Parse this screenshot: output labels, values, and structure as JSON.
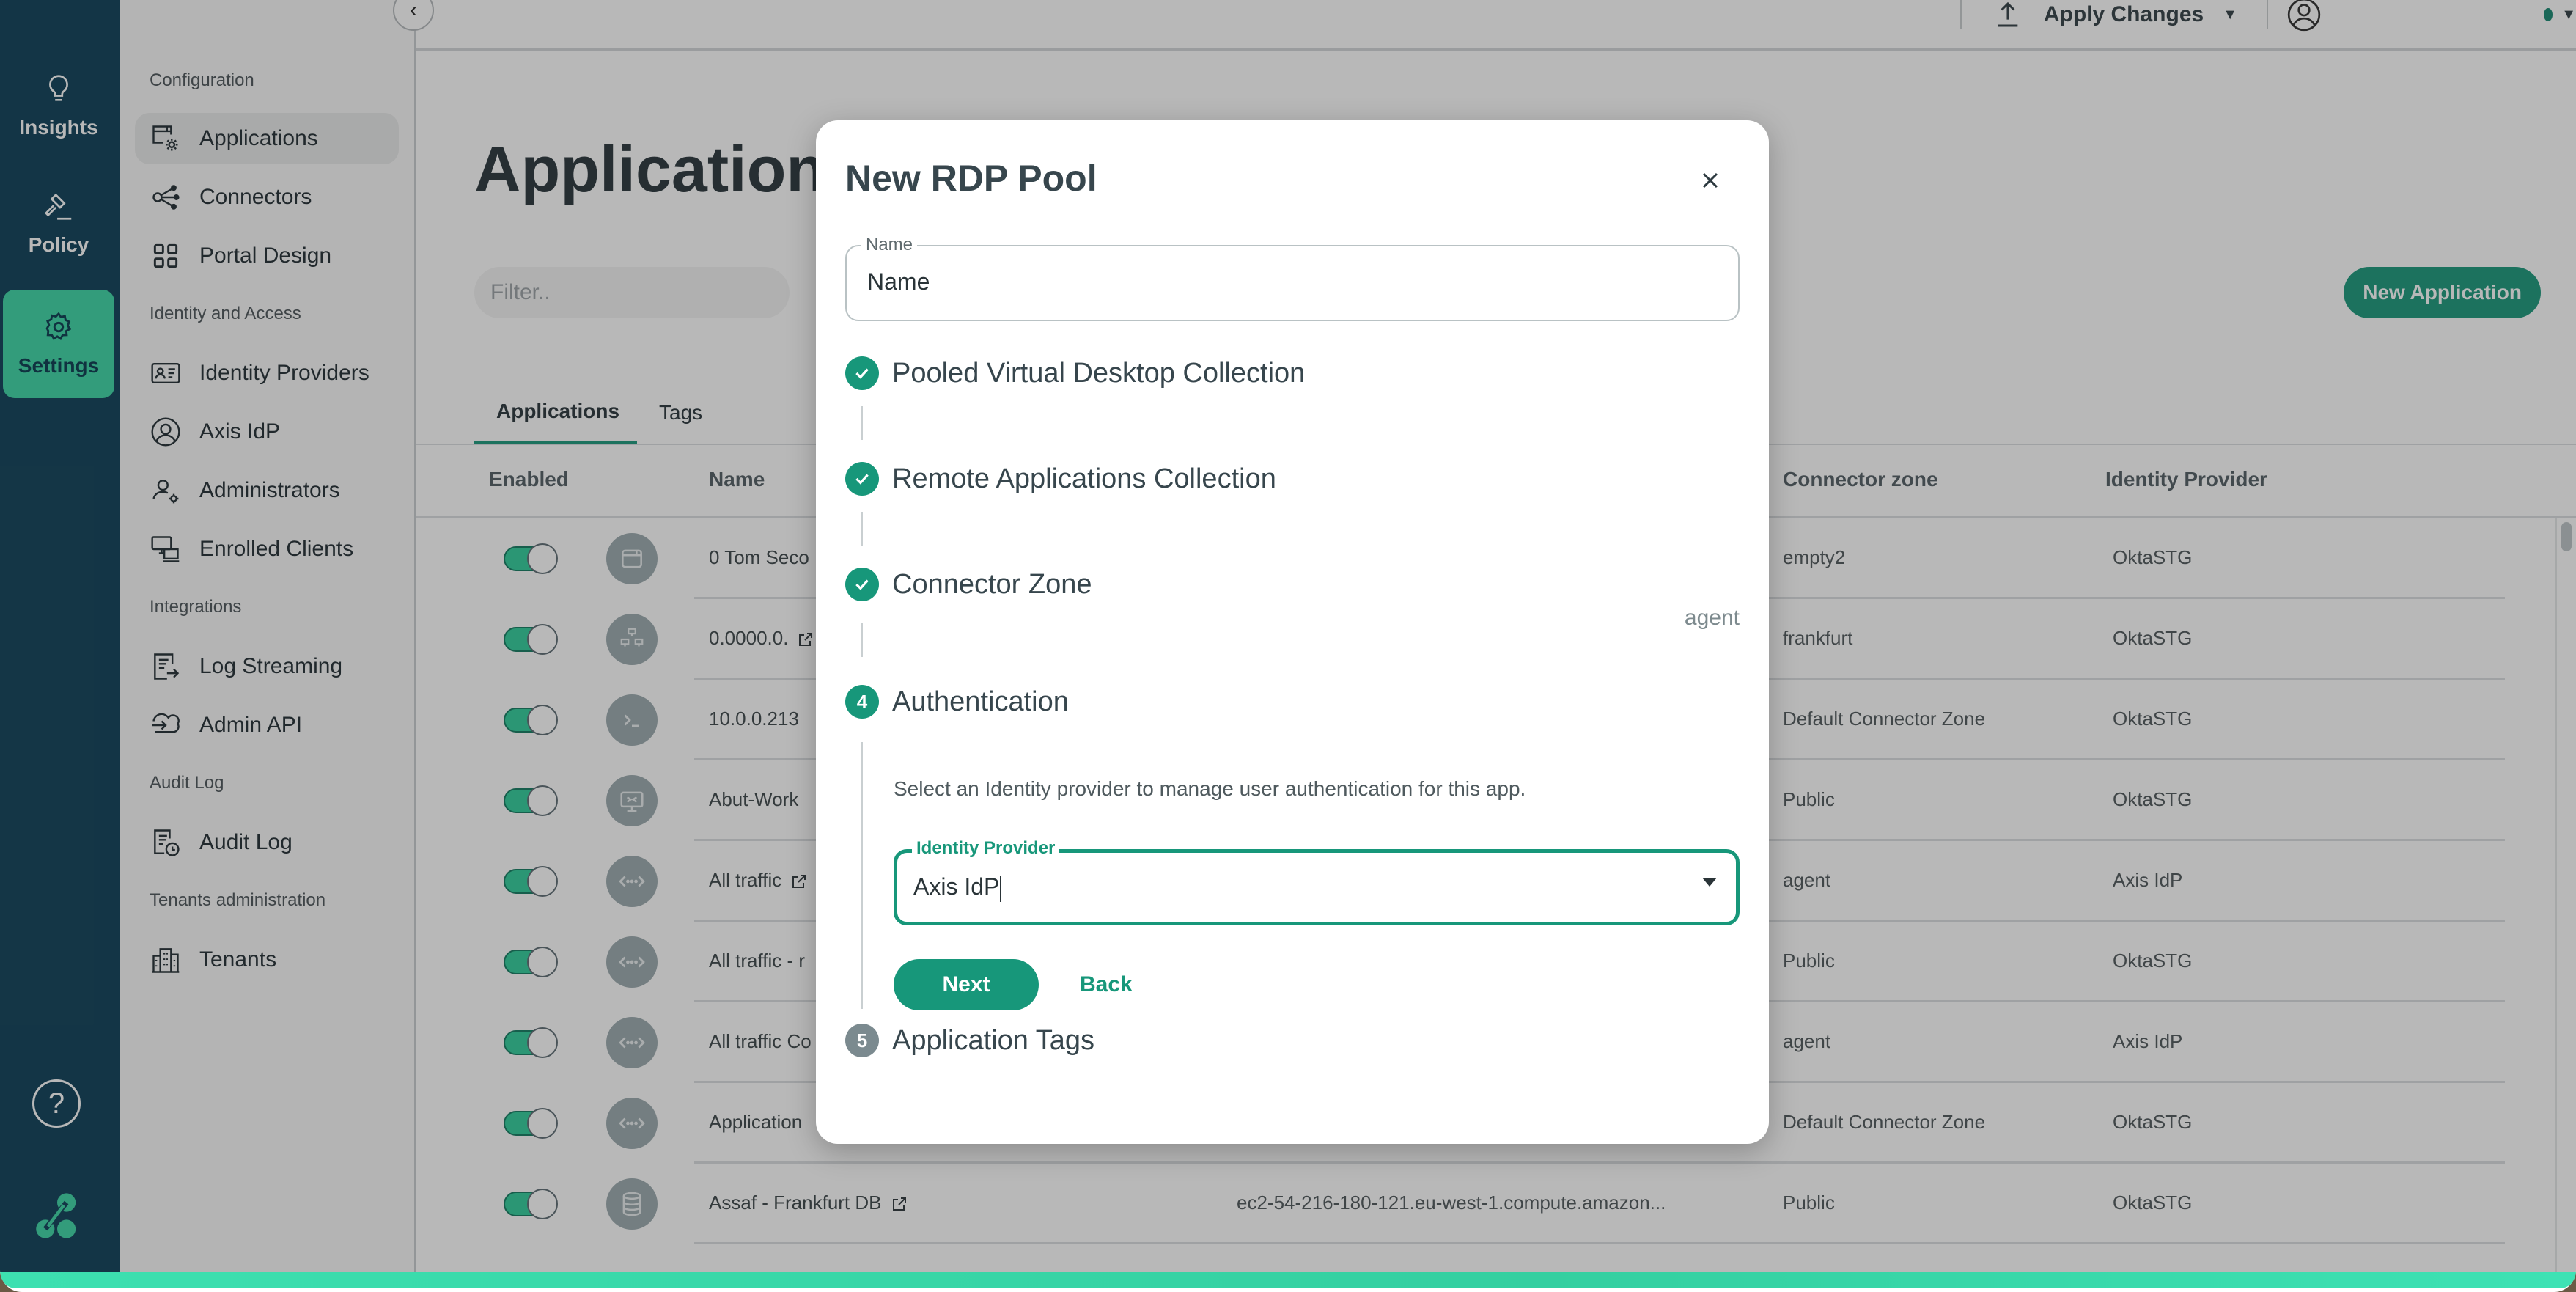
{
  "rail": {
    "items": [
      {
        "label": "Insights",
        "icon": "lightbulb-icon"
      },
      {
        "label": "Policy",
        "icon": "gavel-icon"
      },
      {
        "label": "Settings",
        "icon": "gear-icon",
        "active": true
      }
    ],
    "help_icon": "help-icon",
    "logo_icon": "brand-logo-icon"
  },
  "nav": {
    "sections": [
      {
        "title": "Configuration",
        "items": [
          {
            "label": "Applications",
            "icon": "applications-settings-icon",
            "active": true
          },
          {
            "label": "Connectors",
            "icon": "share-nodes-icon"
          },
          {
            "label": "Portal Design",
            "icon": "grid-icon"
          }
        ]
      },
      {
        "title": "Identity and Access",
        "items": [
          {
            "label": "Identity Providers",
            "icon": "id-card-icon"
          },
          {
            "label": "Axis IdP",
            "icon": "user-circle-icon"
          },
          {
            "label": "Administrators",
            "icon": "user-gear-icon"
          },
          {
            "label": "Enrolled Clients",
            "icon": "devices-icon"
          }
        ]
      },
      {
        "title": "Integrations",
        "items": [
          {
            "label": "Log Streaming",
            "icon": "log-stream-icon"
          },
          {
            "label": "Admin API",
            "icon": "cloud-arrow-icon"
          }
        ]
      },
      {
        "title": "Audit Log",
        "items": [
          {
            "label": "Audit Log",
            "icon": "log-clock-icon"
          }
        ]
      },
      {
        "title": "Tenants administration",
        "items": [
          {
            "label": "Tenants",
            "icon": "buildings-icon"
          }
        ]
      }
    ]
  },
  "topbar": {
    "apply_changes": "Apply Changes"
  },
  "main": {
    "title": "Application S",
    "filter_placeholder": "Filter..",
    "new_application": "New Application",
    "tabs": [
      {
        "label": "Applications",
        "active": true
      },
      {
        "label": "Tags"
      }
    ],
    "columns": {
      "enabled": "Enabled",
      "name": "Name",
      "connector_zone": "Connector zone",
      "identity_provider": "Identity Provider"
    },
    "rows": [
      {
        "enabled": true,
        "type": "web",
        "name": "0 Tom Seco",
        "address": "",
        "zone": "empty2",
        "idp": "OktaSTG",
        "external_link": false
      },
      {
        "enabled": true,
        "type": "network",
        "name": "0.0000.0.",
        "address": "",
        "zone": "frankfurt",
        "idp": "OktaSTG",
        "external_link": true
      },
      {
        "enabled": true,
        "type": "ssh",
        "name": "10.0.0.213",
        "address": "",
        "zone": "Default Connector Zone",
        "idp": "OktaSTG",
        "external_link": false
      },
      {
        "enabled": true,
        "type": "rdp",
        "name": "Abut-Work",
        "address": "",
        "zone": "Public",
        "idp": "OktaSTG",
        "external_link": false
      },
      {
        "enabled": true,
        "type": "tunnel",
        "name": "All traffic",
        "address": "",
        "zone": "agent",
        "idp": "Axis IdP",
        "external_link": true
      },
      {
        "enabled": true,
        "type": "tunnel",
        "name": "All traffic - r",
        "address": "",
        "zone": "Public",
        "idp": "OktaSTG",
        "external_link": false
      },
      {
        "enabled": true,
        "type": "tunnel",
        "name": "All traffic Co",
        "address": "",
        "zone": "agent",
        "idp": "Axis IdP",
        "external_link": false
      },
      {
        "enabled": true,
        "type": "tunnel",
        "name": "Application",
        "address": "",
        "zone": "Default Connector Zone",
        "idp": "OktaSTG",
        "external_link": false
      },
      {
        "enabled": true,
        "type": "database",
        "name": "Assaf - Frankfurt DB",
        "address": "ec2-54-216-180-121.eu-west-1.compute.amazon...",
        "zone": "Public",
        "idp": "OktaSTG",
        "external_link": true
      }
    ]
  },
  "modal": {
    "title": "New RDP Pool",
    "name_field": {
      "label": "Name",
      "placeholder": "Name",
      "value": ""
    },
    "steps": [
      {
        "number": "1",
        "label": "Pooled Virtual Desktop Collection",
        "status": "complete",
        "summary": ""
      },
      {
        "number": "2",
        "label": "Remote Applications Collection",
        "status": "complete",
        "summary": ""
      },
      {
        "number": "3",
        "label": "Connector Zone",
        "status": "complete",
        "summary": "agent"
      },
      {
        "number": "4",
        "label": "Authentication",
        "status": "active",
        "summary": ""
      },
      {
        "number": "5",
        "label": "Application Tags",
        "status": "pending",
        "summary": ""
      }
    ],
    "auth": {
      "description": "Select an Identity provider to manage user authentication for this app.",
      "field_label": "Identity Provider",
      "selected": "Axis IdP",
      "next": "Next",
      "back": "Back"
    }
  },
  "colors": {
    "accent": "#17977a",
    "rail_bg": "#0a3d55",
    "rail_active": "#3ad6a5",
    "pending_step": "#7b8a8f"
  }
}
